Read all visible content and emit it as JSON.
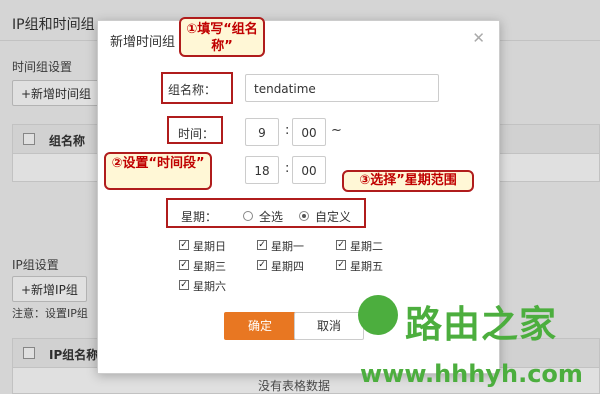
{
  "background": {
    "page_title": "IP组和时间组",
    "time_group_section": "时间组设置",
    "add_time_group_button": "+新增时间组",
    "time_table_header": "组名称",
    "ip_group_section": "IP组设置",
    "add_ip_group_button": "+新增IP组",
    "note": "注意：设置IP组",
    "ip_table_header": "IP组名称",
    "empty_table": "没有表格数据"
  },
  "dialog": {
    "title": "新增时间组",
    "close_icon": "close-icon",
    "group_name_label": "组名称：",
    "group_name_value": "tendatime",
    "time_label": "时间：",
    "start_hour": "9",
    "start_minute": "00",
    "time_sep": ":",
    "range_sep": "~",
    "end_hour": "18",
    "end_minute": "00",
    "week_label": "星期：",
    "week_mode_options": [
      "全选",
      "自定义"
    ],
    "week_mode_selected": "自定义",
    "days": [
      "星期日",
      "星期一",
      "星期二",
      "星期三",
      "星期四",
      "星期五",
      "星期六"
    ],
    "days_checked": [
      true,
      true,
      true,
      true,
      true,
      true,
      true
    ],
    "confirm_button": "确定",
    "cancel_button": "取消"
  },
  "annotations": {
    "callout_1": "①填写“组名称”",
    "callout_2": "②设置“时间段”",
    "callout_3": "③选择”星期范围"
  },
  "watermark": {
    "brand": "路由之家",
    "url": "www.hhhyh.com"
  },
  "colors": {
    "accent": "#e87722",
    "annotation_red": "#b01c1c",
    "watermark_green": "#4cae3e"
  }
}
